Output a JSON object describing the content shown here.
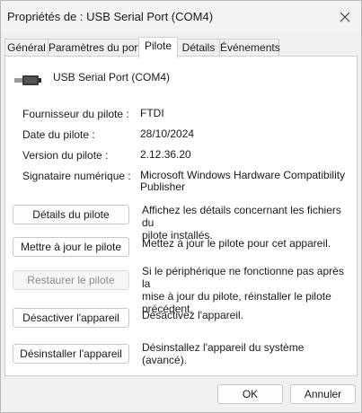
{
  "window": {
    "title": "Propriétés de : USB Serial Port (COM4)"
  },
  "tabs": [
    {
      "label": "Général"
    },
    {
      "label": "Paramètres du port"
    },
    {
      "label": "Pilote"
    },
    {
      "label": "Détails"
    },
    {
      "label": "Événements"
    }
  ],
  "device": {
    "name": "USB Serial Port (COM4)",
    "icon": "usb-connector-icon"
  },
  "properties": [
    {
      "label": "Fournisseur du pilote :",
      "value": "FTDI"
    },
    {
      "label": "Date du pilote :",
      "value": "28/10/2024"
    },
    {
      "label": "Version du pilote :",
      "value": "2.12.36.20"
    },
    {
      "label": "Signataire numérique :",
      "value_line1": "Microsoft Windows Hardware Compatibility",
      "value_line2": "Publisher"
    }
  ],
  "actions": [
    {
      "button": "Détails du pilote",
      "desc1": "Affichez les détails concernant les fichiers du",
      "desc2": "pilote installés."
    },
    {
      "button": "Mettre à jour le pilote",
      "desc1": "Mettez à jour le pilote pour cet appareil."
    },
    {
      "button": "Restaurer le pilote",
      "desc1": "Si le périphérique ne fonctionne pas après la",
      "desc2": "mise à jour du pilote, réinstaller le pilote",
      "desc3": "précédent."
    },
    {
      "button": "Désactiver l'appareil",
      "desc1": "Désactivez l'appareil."
    },
    {
      "button": "Désinstaller l'appareil",
      "desc1": "Désinstallez l'appareil du système (avancé)."
    }
  ],
  "footer": {
    "ok_label": "OK",
    "cancel_label": "Annuler"
  }
}
